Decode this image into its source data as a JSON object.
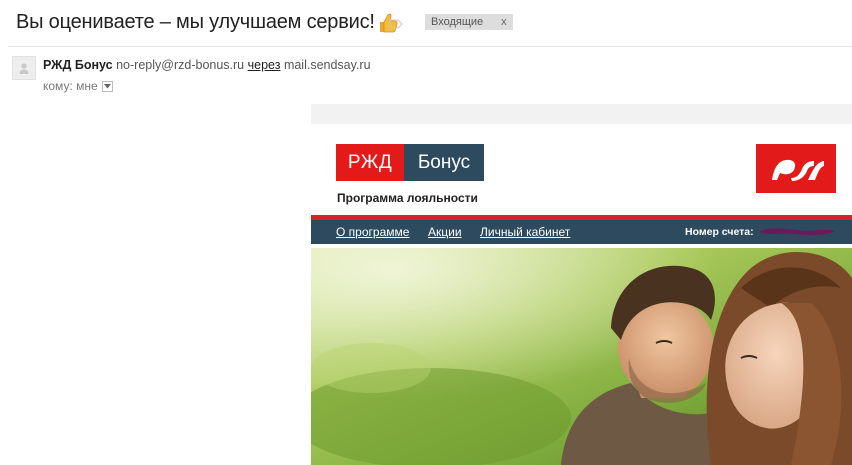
{
  "subject": {
    "title": "Вы оцениваете – мы улучшаем сервис!",
    "emoji_icon": "thumbs-up-icon",
    "label_icon": "label-tag-icon",
    "chip_label": "Входящие",
    "chip_close": "x"
  },
  "sender": {
    "avatar_icon": "person-icon",
    "name": "РЖД Бонус",
    "email": "no-reply@rzd-bonus.ru",
    "via_text": "через",
    "via_domain": "mail.sendsay.ru",
    "recipient_text": "кому: мне",
    "recipient_dropdown_icon": "chevron-down-icon"
  },
  "email_body": {
    "logo": {
      "left": "РЖД",
      "right": "Бонус"
    },
    "program_label": "Программа лояльности",
    "emblem_icon": "rzd-logo-icon",
    "nav": {
      "links": [
        {
          "label": "О программе"
        },
        {
          "label": "Акции"
        },
        {
          "label": "Личный кабинет"
        }
      ],
      "account_label": "Номер счета:"
    },
    "hero_image": "couple-on-grass-photo"
  },
  "colors": {
    "brand_red": "#e21a1a",
    "brand_navy": "#2d4a5e",
    "stripe_red": "#d8222a",
    "redaction": "#6a1a5a"
  }
}
